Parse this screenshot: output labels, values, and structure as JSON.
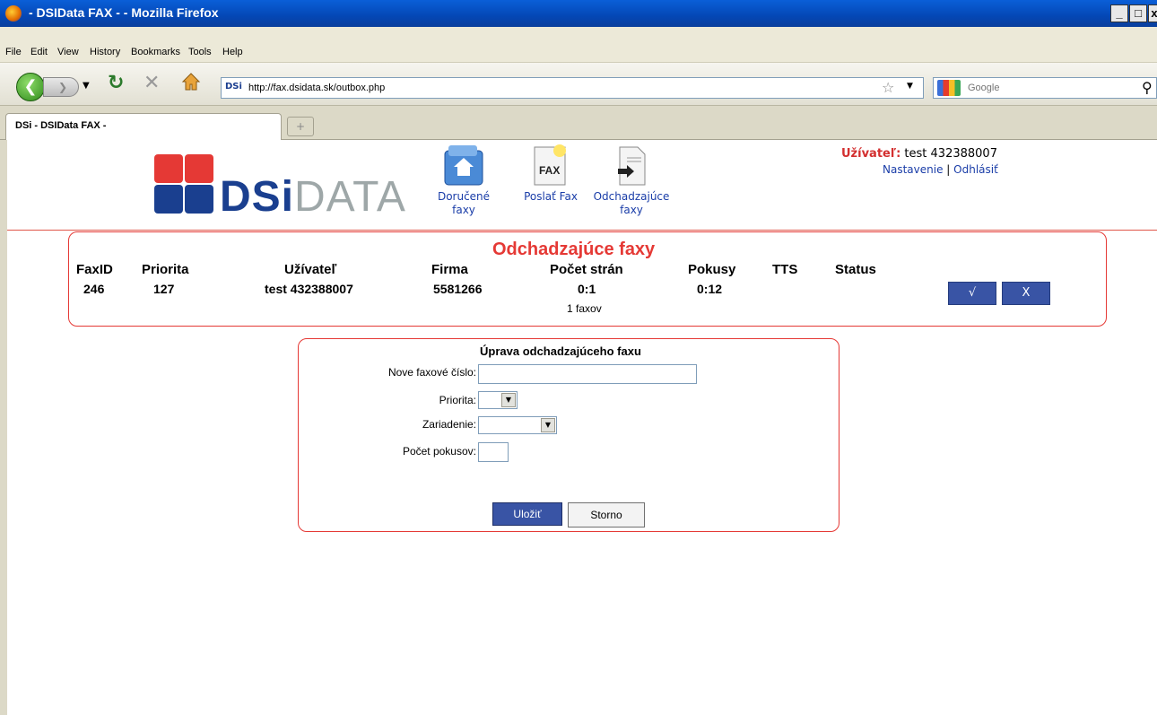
{
  "window": {
    "title": " - DSIData FAX - - Mozilla Firefox",
    "minimize": "_",
    "maximize": "□",
    "close": "x"
  },
  "menu": [
    "File",
    "Edit",
    "View",
    "History",
    "Bookmarks",
    "Tools",
    "Help"
  ],
  "navbar": {
    "url": "http://fax.dsidata.sk/outbox.php",
    "site_icon": "DSi",
    "search_placeholder": "Google"
  },
  "tab": {
    "label": "DSi - DSIData FAX -",
    "new_tab": "+"
  },
  "header": {
    "logo_dsi": "DSi",
    "logo_data": "DATA",
    "nav": [
      {
        "label_1": "Doručené",
        "label_2": "faxy"
      },
      {
        "label_1": "Poslať Fax",
        "label_2": ""
      },
      {
        "label_1": "Odchadzajúce",
        "label_2": "faxy"
      }
    ],
    "fax_icon_text": "FAX",
    "user_label": "Užívateľ:",
    "user_name": " test 432388007",
    "settings_link": "Nastavenie",
    "separator": "|",
    "logout_link": "Odhlásiť"
  },
  "outbox": {
    "title": "Odchadzajúce faxy",
    "columns": [
      "FaxID",
      "Priorita",
      "Užívateľ",
      "Firma",
      "Počet strán",
      "Pokusy",
      "TTS",
      "Status"
    ],
    "row": [
      "246",
      "127",
      "test 432388007",
      "5581266",
      "0:1",
      "0:12",
      "",
      ""
    ],
    "count": "1 faxov",
    "confirm_button": "√",
    "delete_button": "X"
  },
  "edit_form": {
    "title": "Úprava odchadzajúceho faxu",
    "fax_number_label": "Nove faxové číslo:",
    "fax_number_value": "",
    "priority_label": "Priorita:",
    "priority_value": "",
    "device_label": "Zariadenie:",
    "device_value": "",
    "attempts_label": "Počet pokusov:",
    "attempts_value": "",
    "save_button": "Uložiť",
    "cancel_button": "Storno"
  },
  "colors": {
    "accent_red": "#e53935",
    "link_blue": "#1a3da8",
    "button_blue": "#3954a5",
    "logo_blue": "#1a3f8f",
    "logo_red": "#d32f2f",
    "logo_grey": "#9ea7a8"
  }
}
